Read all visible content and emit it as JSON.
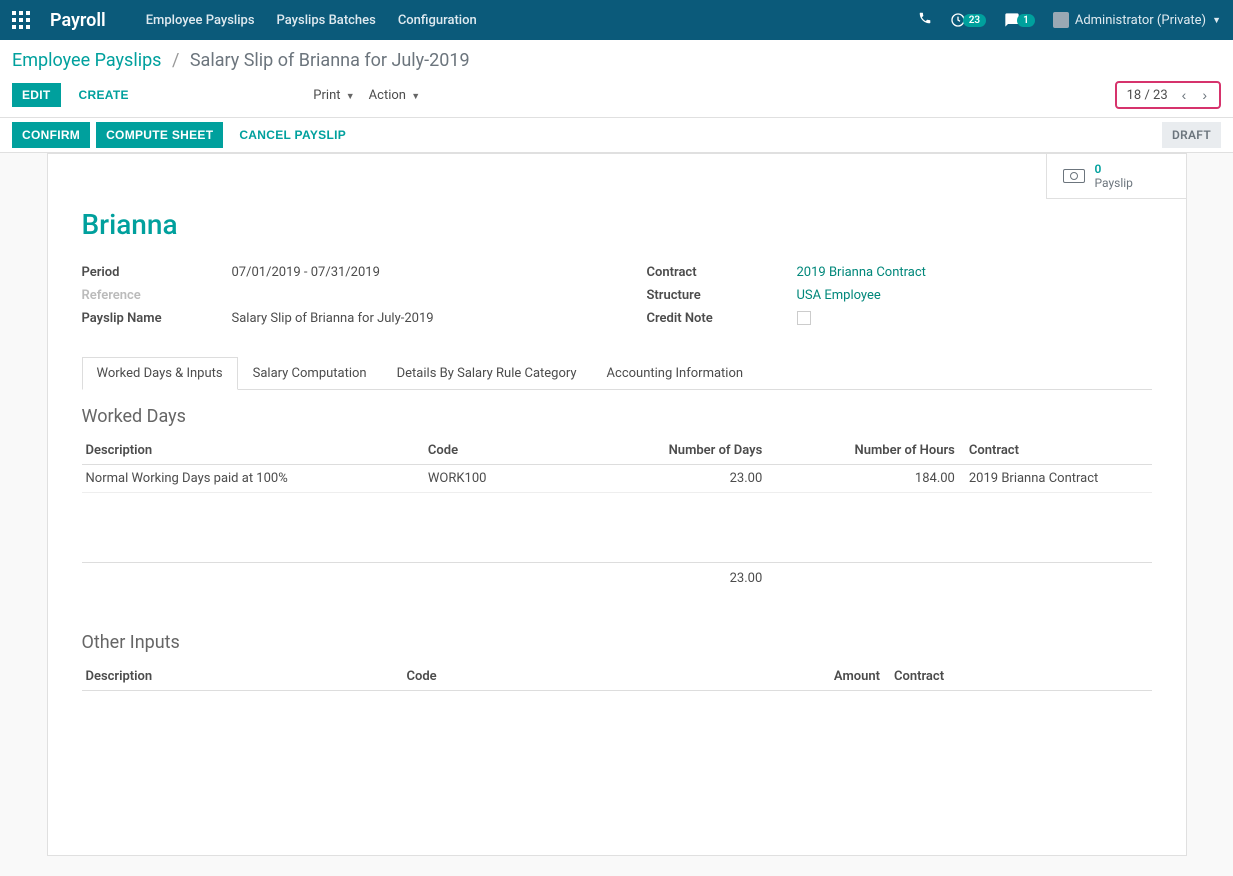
{
  "nav": {
    "brand": "Payroll",
    "links": [
      "Employee Payslips",
      "Payslips Batches",
      "Configuration"
    ],
    "activity_badge": "23",
    "discuss_badge": "1",
    "user": "Administrator (Private)"
  },
  "breadcrumb": {
    "parent": "Employee Payslips",
    "current": "Salary Slip of Brianna for July-2019"
  },
  "toolbar": {
    "edit": "EDIT",
    "create": "CREATE",
    "print": "Print",
    "action": "Action",
    "pager": "18 / 23"
  },
  "status": {
    "confirm": "CONFIRM",
    "compute": "COMPUTE SHEET",
    "cancel": "CANCEL PAYSLIP",
    "state": "DRAFT"
  },
  "stat": {
    "count": "0",
    "label": "Payslip"
  },
  "record": {
    "title": "Brianna",
    "fields_left": {
      "period_label": "Period",
      "period": "07/01/2019 - 07/31/2019",
      "reference_label": "Reference",
      "reference": "",
      "name_label": "Payslip Name",
      "name": "Salary Slip of Brianna for July-2019"
    },
    "fields_right": {
      "contract_label": "Contract",
      "contract": "2019 Brianna Contract",
      "structure_label": "Structure",
      "structure": "USA Employee",
      "credit_label": "Credit Note"
    }
  },
  "tabs": [
    "Worked Days & Inputs",
    "Salary Computation",
    "Details By Salary Rule Category",
    "Accounting Information"
  ],
  "worked_days": {
    "title": "Worked Days",
    "headers": {
      "desc": "Description",
      "code": "Code",
      "days": "Number of Days",
      "hours": "Number of Hours",
      "contract": "Contract"
    },
    "rows": [
      {
        "desc": "Normal Working Days paid at 100%",
        "code": "WORK100",
        "days": "23.00",
        "hours": "184.00",
        "contract": "2019 Brianna Contract"
      }
    ],
    "total_days": "23.00"
  },
  "other_inputs": {
    "title": "Other Inputs",
    "headers": {
      "desc": "Description",
      "code": "Code",
      "amount": "Amount",
      "contract": "Contract"
    }
  }
}
